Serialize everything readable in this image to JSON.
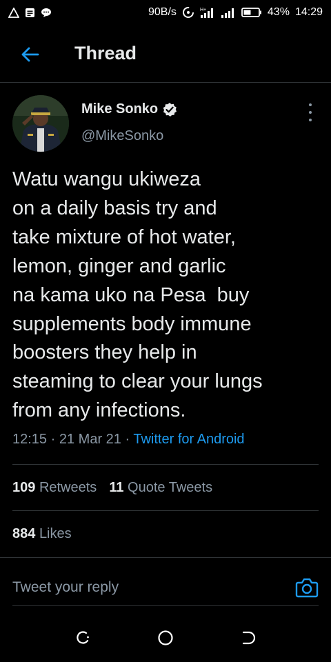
{
  "status_bar": {
    "network_speed": "90B/s",
    "battery": "43%",
    "time": "14:29"
  },
  "header": {
    "title": "Thread"
  },
  "tweet": {
    "author_name": "Mike Sonko",
    "author_handle": "@MikeSonko",
    "text_lines": [
      "Watu wangu ukiweza",
      "on a daily basis try and",
      "take mixture of hot water,",
      "lemon, ginger and garlic",
      "na kama uko na Pesa  buy",
      "supplements body immune",
      "boosters they help in",
      "steaming to clear your lungs",
      "from any infections."
    ],
    "time": "12:15",
    "date": "21 Mar 21",
    "separator": "·",
    "source": "Twitter for Android"
  },
  "stats": {
    "retweets_count": "109",
    "retweets_label": "Retweets",
    "quotes_count": "11",
    "quotes_label": "Quote Tweets",
    "likes_count": "884",
    "likes_label": "Likes"
  },
  "reply": {
    "placeholder": "Tweet your reply"
  },
  "colors": {
    "background": "#000000",
    "text": "#e7e9ea",
    "secondary_text": "#8b98a5",
    "accent": "#1d9bf0",
    "divider": "#2f3336"
  },
  "icons": {
    "back": "arrow-left-icon",
    "verified": "verified-badge-icon",
    "more": "more-vertical-icon",
    "camera": "camera-icon",
    "nav_recent": "recent-apps-icon",
    "nav_home": "home-circle-icon",
    "nav_back": "nav-back-icon"
  }
}
